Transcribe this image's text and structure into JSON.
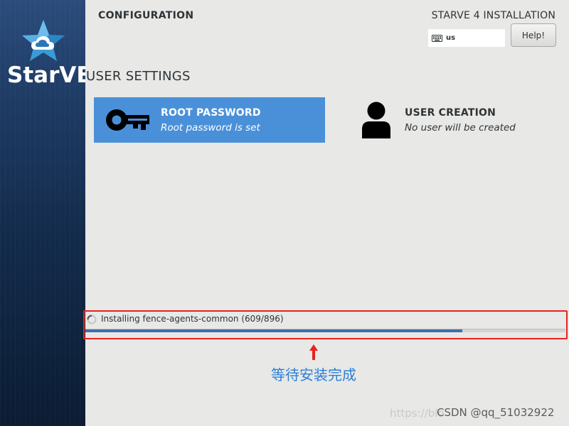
{
  "sidebar": {
    "brand_name": "StarVE",
    "logo_icon": "star-cloud-logo-icon"
  },
  "header": {
    "config_title": "CONFIGURATION",
    "install_title": "STARVE 4 INSTALLATION",
    "keyboard_layout": "us",
    "keyboard_icon": "keyboard-icon",
    "help_label": "Help!"
  },
  "user_settings": {
    "title": "USER SETTINGS",
    "root_password": {
      "name": "ROOT PASSWORD",
      "status": "Root password is set",
      "icon": "key-icon"
    },
    "user_creation": {
      "name": "USER CREATION",
      "status": "No user will be created",
      "icon": "user-icon"
    }
  },
  "progress": {
    "label": "Installing fence-agents-common (609/896)",
    "completed": 609,
    "total": 896,
    "fraction": 0.785
  },
  "annotation": {
    "text": "等待安装完成",
    "color": "#e8231c"
  },
  "watermark": {
    "faded": "https://blo",
    "text": "CSDN @qq_51032922"
  },
  "colors": {
    "accent": "#4a90d9",
    "progress_fill": "#3f6fad",
    "annotation_text": "#2b7fd6"
  }
}
